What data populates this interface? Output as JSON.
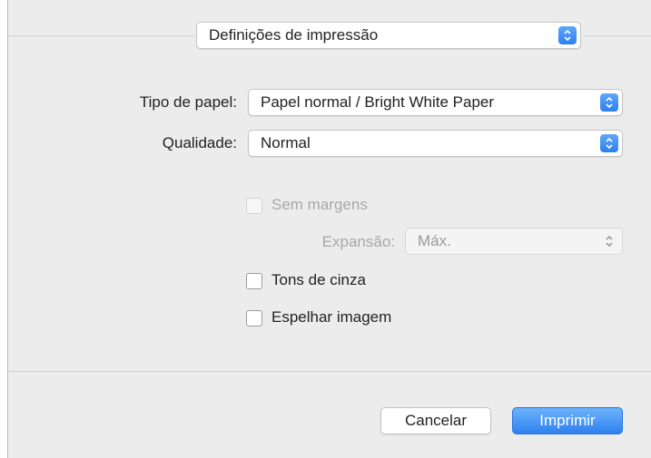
{
  "section_popup": {
    "value": "Definições de impressão"
  },
  "paper_type": {
    "label": "Tipo de papel:",
    "value": "Papel normal / Bright White Paper"
  },
  "quality": {
    "label": "Qualidade:",
    "value": "Normal"
  },
  "borderless": {
    "label": "Sem margens",
    "checked": false,
    "enabled": false
  },
  "expansion": {
    "label": "Expansão:",
    "value": "Máx.",
    "enabled": false
  },
  "grayscale": {
    "label": "Tons de cinza",
    "checked": false
  },
  "mirror": {
    "label": "Espelhar imagem",
    "checked": false
  },
  "buttons": {
    "cancel": "Cancelar",
    "print": "Imprimir"
  },
  "colors": {
    "accent": "#2f80f0",
    "panel": "#ececec"
  }
}
